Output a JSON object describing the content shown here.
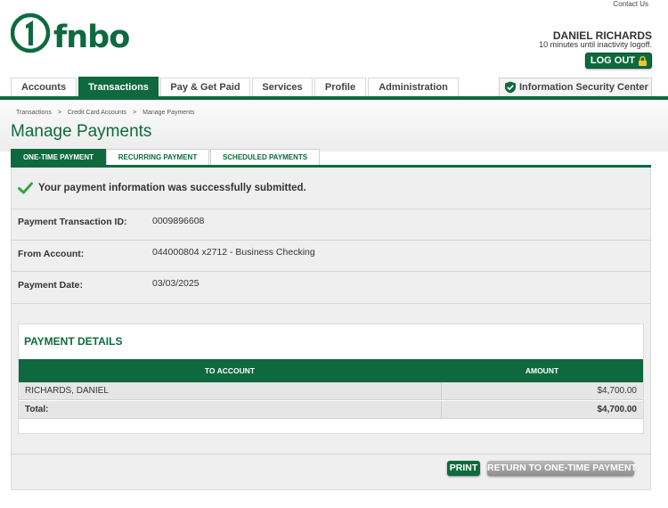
{
  "header": {
    "contact_link": "Contact Us",
    "brand": "fnbo",
    "user_name": "DANIEL RICHARDS",
    "inactivity": "10 minutes until inactivity logoff.",
    "logout_label": "LOG OUT"
  },
  "nav": {
    "tabs": [
      "Accounts",
      "Transactions",
      "Pay & Get Paid",
      "Services",
      "Profile",
      "Administration"
    ],
    "active": "Transactions",
    "security_center": "Information Security Center"
  },
  "breadcrumb": [
    "Transactions",
    "Credit Card Accounts",
    "Manage Payments"
  ],
  "page_title": "Manage Payments",
  "sub_tabs": [
    "ONE-TIME PAYMENT",
    "RECURRING PAYMENT",
    "SCHEDULED PAYMENTS"
  ],
  "success_message": "Your payment information was successfully submitted.",
  "info": [
    {
      "label": "Payment Transaction ID:",
      "value": "0009896608"
    },
    {
      "label": "From Account:",
      "value": "044000804 x2712 - Business Checking"
    },
    {
      "label": "Payment Date:",
      "value": "03/03/2025"
    }
  ],
  "payment_details": {
    "title": "PAYMENT DETAILS",
    "columns": [
      "TO ACCOUNT",
      "AMOUNT"
    ],
    "rows": [
      {
        "account": "RICHARDS, DANIEL",
        "amount": "$4,700.00"
      }
    ],
    "total_label": "Total:",
    "total_amount": "$4,700.00"
  },
  "buttons": {
    "print": "PRINT",
    "return": "RETURN TO ONE-TIME PAYMENT"
  },
  "colors": {
    "brand_green": "#0e6a3e",
    "panel_bg": "#efefef"
  }
}
